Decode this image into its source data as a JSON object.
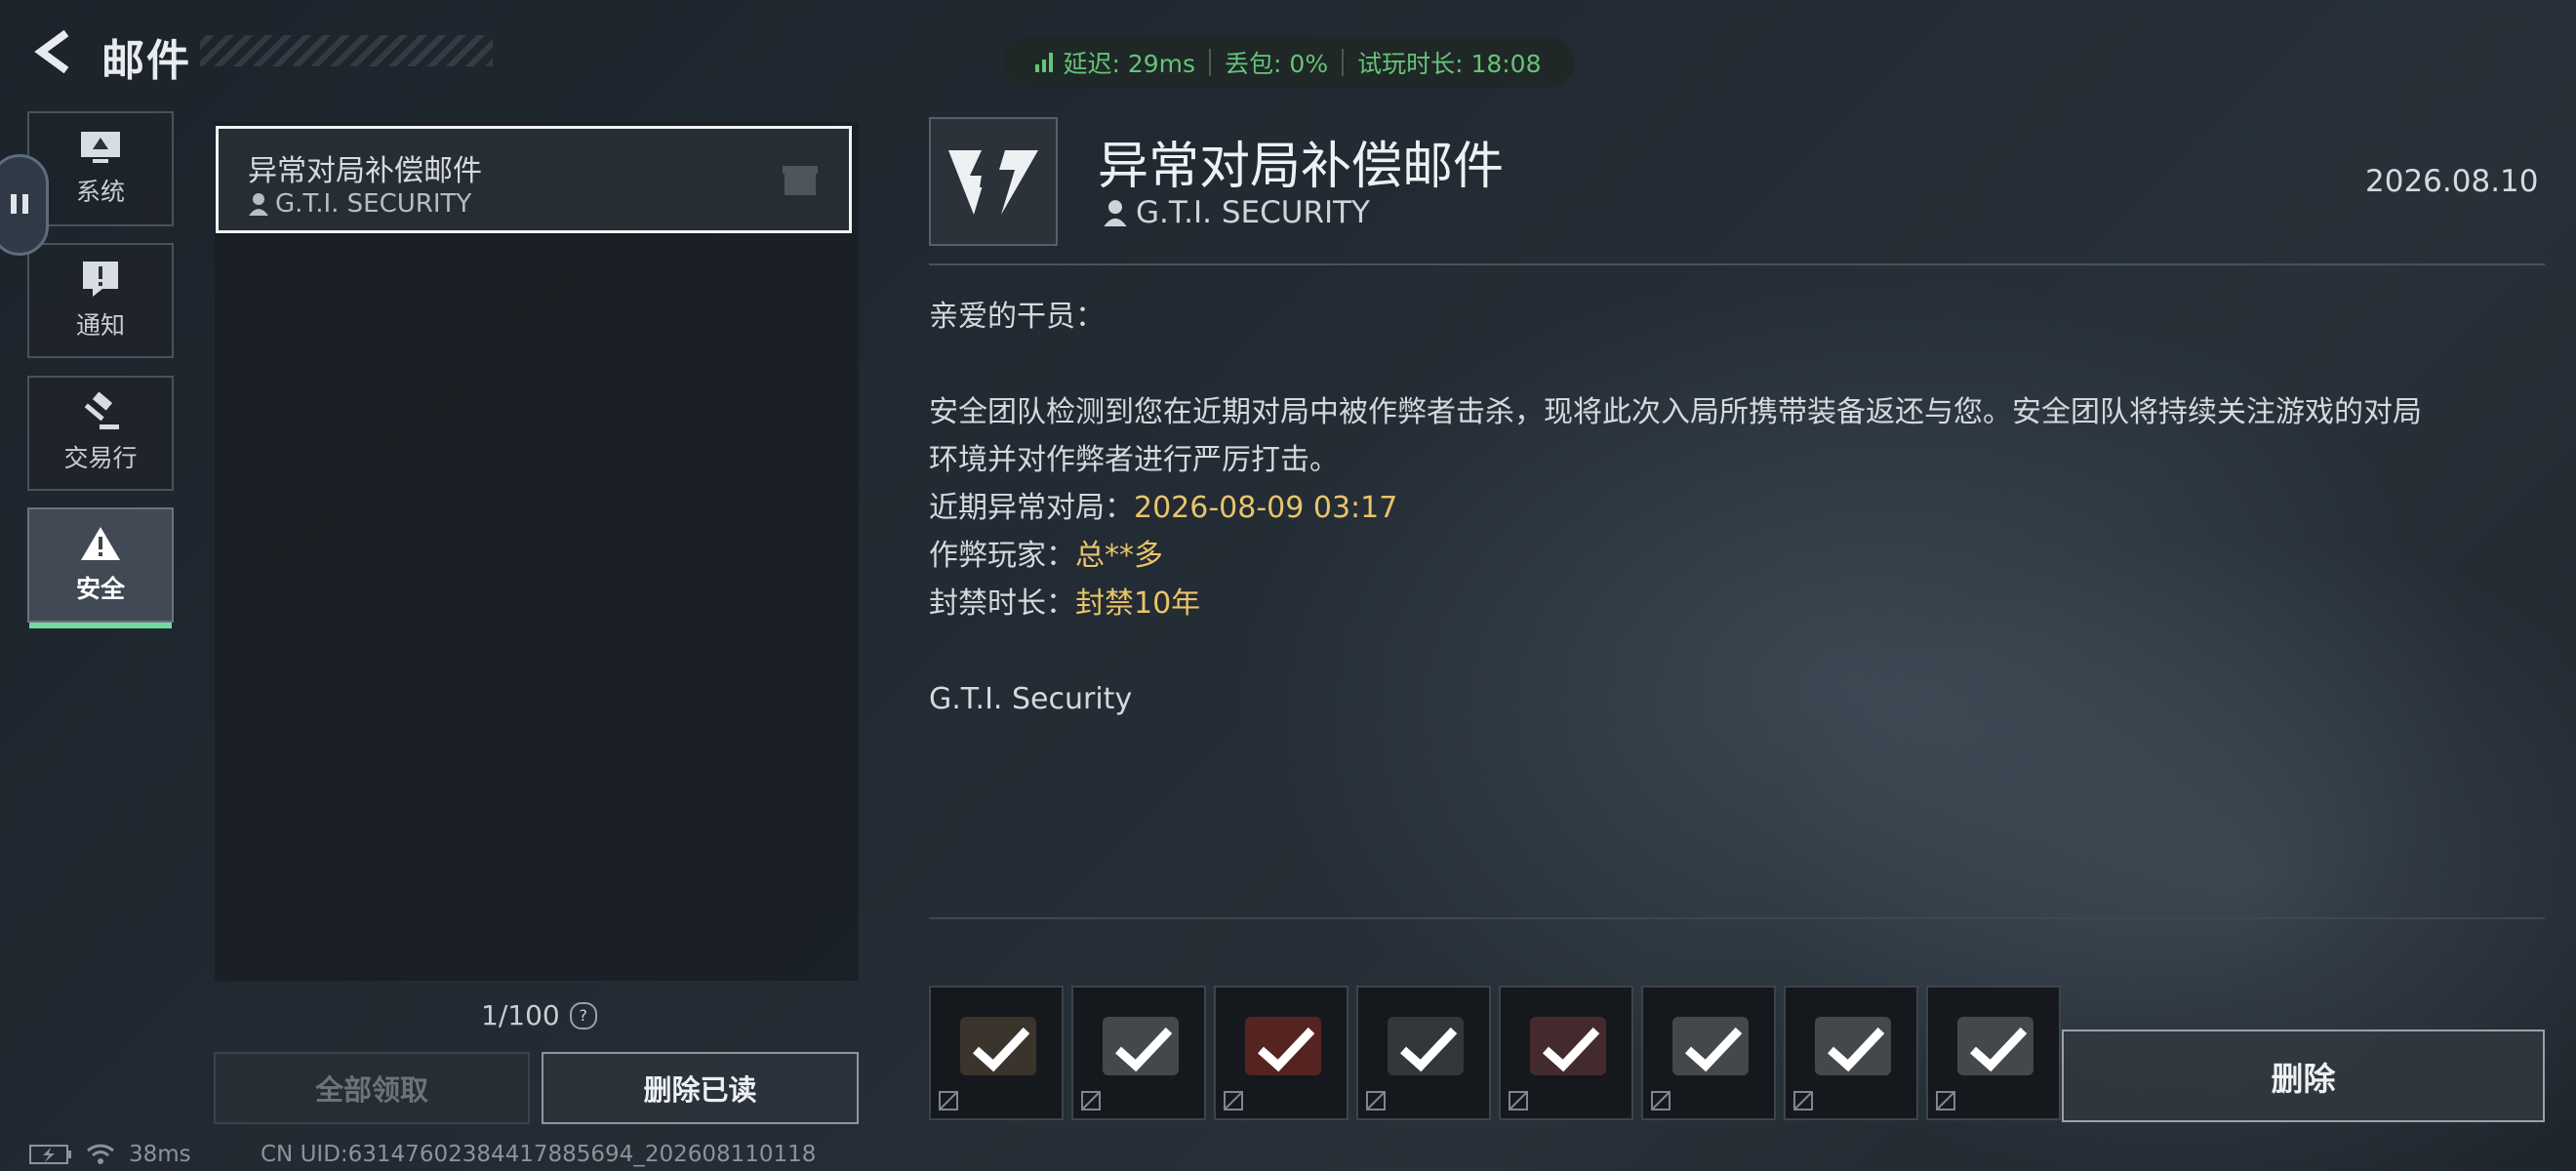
{
  "header": {
    "title": "邮件",
    "back_icon": "back-arrow-icon"
  },
  "netstat": {
    "latency": "延迟: 29ms",
    "loss": "丢包: 0%",
    "trial": "试玩时长: 18:08",
    "color": "#66c37a"
  },
  "sidebar": {
    "items": [
      {
        "label": "系统",
        "icon": "monitor-icon",
        "active": false
      },
      {
        "label": "通知",
        "icon": "alert-bubble-icon",
        "active": false
      },
      {
        "label": "交易行",
        "icon": "gavel-icon",
        "active": false
      },
      {
        "label": "安全",
        "icon": "warning-triangle-icon",
        "active": true
      }
    ],
    "active_color": "#6fdba0"
  },
  "list": {
    "items": [
      {
        "title": "异常对局补偿邮件",
        "sender": "G.T.I. SECURITY"
      }
    ],
    "count": "1/100",
    "help": "?",
    "claim_all": "全部领取",
    "delete_read": "删除已读"
  },
  "detail": {
    "title": "异常对局补偿邮件",
    "sender": "G.T.I. SECURITY",
    "date": "2026.08.10",
    "greeting": "亲爱的干员：",
    "para1": "安全团队检测到您在近期对局中被作弊者击杀，现将此次入局所携带装备返还与您。安全团队将持续关注游戏的对局",
    "para2": "环境并对作弊者进行严厉打击。",
    "match_label": "近期异常对局：",
    "match_value": "2026-08-09 03:17",
    "cheater_label": "作弊玩家：",
    "cheater_value": "总**多",
    "ban_label": "封禁时长：",
    "ban_value": "封禁10年",
    "signature": "G.T.I. Security",
    "highlight_color": "#e9c46a",
    "attachments_count": 8,
    "delete": "删除"
  },
  "footer": {
    "ping": "38ms",
    "uid": "CN UID:63147602384417885694_202608110118"
  }
}
